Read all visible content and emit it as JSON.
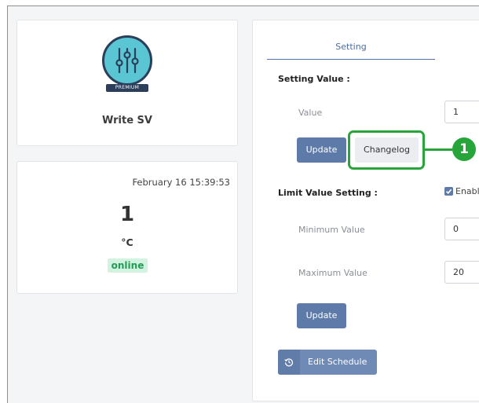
{
  "widget": {
    "badge": "PREMIUM",
    "title": "Write SV"
  },
  "status": {
    "timestamp": "February 16 15:39:53",
    "value": "1",
    "unit": "°C",
    "state": "online"
  },
  "tabs": [
    {
      "label": "Setting"
    }
  ],
  "setting_value": {
    "section_title": "Setting Value :",
    "value_label": "Value",
    "value": "1",
    "update_label": "Update",
    "changelog_label": "Changelog"
  },
  "callout": {
    "number": "1"
  },
  "limit_setting": {
    "section_title": "Limit Value Setting :",
    "enable_label": "Enabl",
    "enabled": true,
    "min_label": "Minimum Value",
    "min_value": "0",
    "max_label": "Maximum Value",
    "max_value": "20",
    "update_label": "Update"
  },
  "schedule": {
    "button_label": "Edit Schedule"
  },
  "colors": {
    "primary": "#5d7aa8",
    "online": "#1f9d55",
    "highlight": "#27a53a",
    "icon_bg": "#5bc6d3"
  },
  "icons": {
    "widget": "sliders-icon",
    "schedule": "history-icon",
    "checkbox": "check-icon"
  }
}
